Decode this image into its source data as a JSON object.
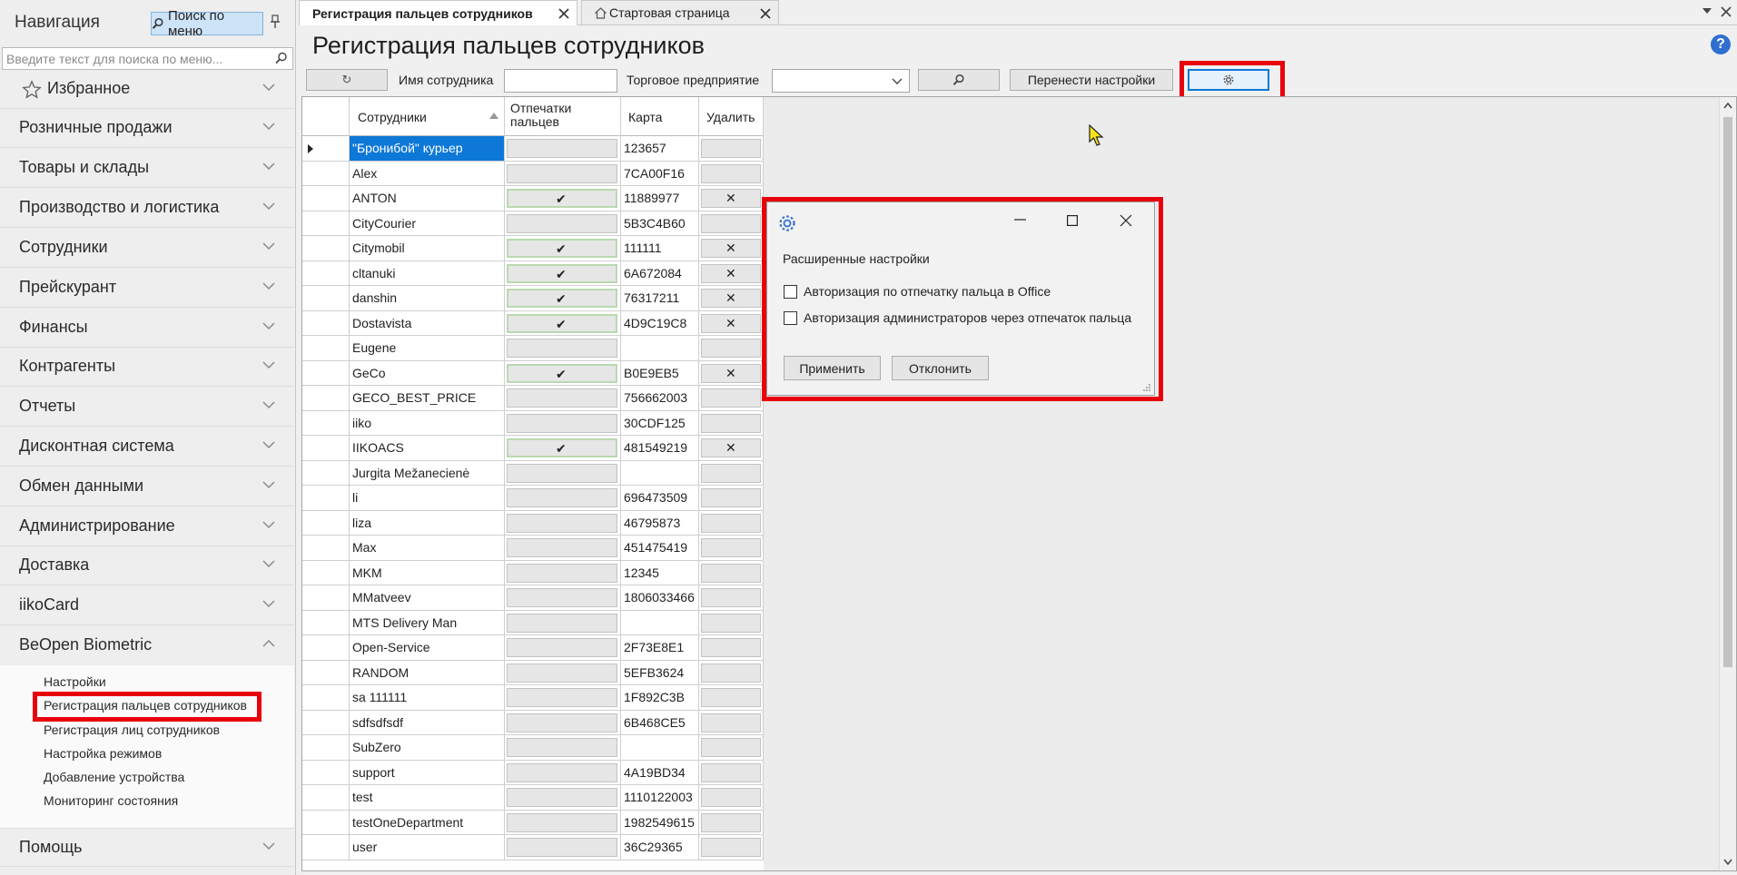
{
  "nav": {
    "title": "Навигация",
    "search_button": "Поиск по меню",
    "search_placeholder": "Введите текст для поиска по меню...",
    "items": [
      {
        "label": "Избранное"
      },
      {
        "label": "Розничные продажи"
      },
      {
        "label": "Товары и склады"
      },
      {
        "label": "Производство и логистика"
      },
      {
        "label": "Сотрудники"
      },
      {
        "label": "Прейскурант"
      },
      {
        "label": "Финансы"
      },
      {
        "label": "Контрагенты"
      },
      {
        "label": "Отчеты"
      },
      {
        "label": "Дисконтная система"
      },
      {
        "label": "Обмен данными"
      },
      {
        "label": "Администрирование"
      },
      {
        "label": "Доставка"
      },
      {
        "label": "iikoCard"
      },
      {
        "label": "BeOpen Biometric"
      }
    ],
    "subitems": [
      {
        "label": "Настройки"
      },
      {
        "label": "Регистрация пальцев сотрудников"
      },
      {
        "label": "Регистрация лиц сотрудников"
      },
      {
        "label": "Настройка режимов"
      },
      {
        "label": "Добавление устройства"
      },
      {
        "label": "Мониторинг состояния"
      }
    ],
    "help": "Помощь"
  },
  "tabs": [
    {
      "label": "Регистрация пальцев сотрудников"
    },
    {
      "label": "Стартовая страница"
    }
  ],
  "page": {
    "title": "Регистрация пальцев сотрудников",
    "refresh_icon": "↻",
    "employee_name_label": "Имя сотрудника",
    "employee_name_value": "",
    "enterprise_label": "Торговое предприятие",
    "enterprise_value": "",
    "transfer_button": "Перенести настройки",
    "help_icon": "?"
  },
  "grid": {
    "columns": [
      "Сотрудники",
      "Отпечатки пальцев",
      "Карта",
      "Удалить"
    ],
    "rows": [
      {
        "name": "\"Бронибой\" курьер",
        "fp": false,
        "card": "123657"
      },
      {
        "name": "Alex",
        "fp": false,
        "card": "7CA00F16"
      },
      {
        "name": "ANTON",
        "fp": true,
        "card": "11889977"
      },
      {
        "name": "CityCourier",
        "fp": false,
        "card": "5B3C4B60"
      },
      {
        "name": "Citymobil",
        "fp": true,
        "card": "111111"
      },
      {
        "name": "cltanuki",
        "fp": true,
        "card": "6A672084"
      },
      {
        "name": "danshin",
        "fp": true,
        "card": "76317211"
      },
      {
        "name": "Dostavista",
        "fp": true,
        "card": "4D9C19C8"
      },
      {
        "name": "Eugene",
        "fp": false,
        "card": ""
      },
      {
        "name": "GeCo",
        "fp": true,
        "card": "B0E9EB5"
      },
      {
        "name": "GECO_BEST_PRICE",
        "fp": false,
        "card": "756662003"
      },
      {
        "name": "iiko",
        "fp": false,
        "card": "30CDF125"
      },
      {
        "name": "IIKOACS",
        "fp": true,
        "card": "481549219"
      },
      {
        "name": "Jurgita Mežanecienė",
        "fp": false,
        "card": ""
      },
      {
        "name": "li",
        "fp": false,
        "card": "696473509"
      },
      {
        "name": "liza",
        "fp": false,
        "card": "46795873"
      },
      {
        "name": "Max",
        "fp": false,
        "card": "451475419"
      },
      {
        "name": "MKM",
        "fp": false,
        "card": "12345"
      },
      {
        "name": "MMatveev",
        "fp": false,
        "card": "1806033466"
      },
      {
        "name": "MTS Delivery Man",
        "fp": false,
        "card": ""
      },
      {
        "name": "Open-Service",
        "fp": false,
        "card": "2F73E8E1"
      },
      {
        "name": "RANDOM",
        "fp": false,
        "card": "5EFB3624"
      },
      {
        "name": "sa 111111",
        "fp": false,
        "card": "1F892C3B"
      },
      {
        "name": "sdfsdfsdf",
        "fp": false,
        "card": "6B468CE5"
      },
      {
        "name": "SubZero",
        "fp": false,
        "card": ""
      },
      {
        "name": "support",
        "fp": false,
        "card": "4A19BD34"
      },
      {
        "name": "test",
        "fp": false,
        "card": "1110122003"
      },
      {
        "name": "testOneDepartment",
        "fp": false,
        "card": "1982549615"
      },
      {
        "name": "user",
        "fp": false,
        "card": "36C29365"
      }
    ],
    "check_glyph": "✔",
    "delete_glyph": "✕"
  },
  "dialog": {
    "heading": "Расширенные настройки",
    "option1": "Авторизация по отпечатку пальца в Office",
    "option2": "Авторизация администраторов через отпечаток пальца",
    "option1_checked": false,
    "option2_checked": false,
    "apply": "Применить",
    "cancel": "Отклонить"
  },
  "colors": {
    "accent": "#0d78d7",
    "highlight": "#e8000c",
    "check_border": "#b9d9b0"
  }
}
